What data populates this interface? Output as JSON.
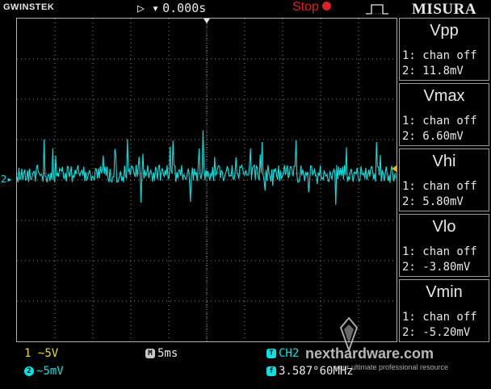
{
  "header": {
    "brand": "GWINSTEK",
    "trigger_glyph": "▷ ▾",
    "trigger_time": "0.000s",
    "run_status": "Stop",
    "watermark_title": "MISURA"
  },
  "measurements": [
    {
      "name": "Vpp",
      "ch1": "1: chan off",
      "ch2": "2: 11.8mV"
    },
    {
      "name": "Vmax",
      "ch1": "1: chan off",
      "ch2": "2: 6.60mV"
    },
    {
      "name": "Vhi",
      "ch1": "1: chan off",
      "ch2": "2: 5.80mV"
    },
    {
      "name": "Vlo",
      "ch1": "1: chan off",
      "ch2": "2: -3.80mV"
    },
    {
      "name": "Vmin",
      "ch1": "1: chan off",
      "ch2": "2: -5.20mV"
    }
  ],
  "bottom": {
    "ch1_scale": "5V",
    "ch2_scale": "5mV",
    "timebase": "5ms",
    "trigger_source": "CH2",
    "frequency": "3.587°60MHz"
  },
  "channel_marker": "2",
  "waveform_color": "#00e5e5",
  "watermark": {
    "site": "nexthardware.com",
    "tagline": "your ultimate professional resource"
  }
}
